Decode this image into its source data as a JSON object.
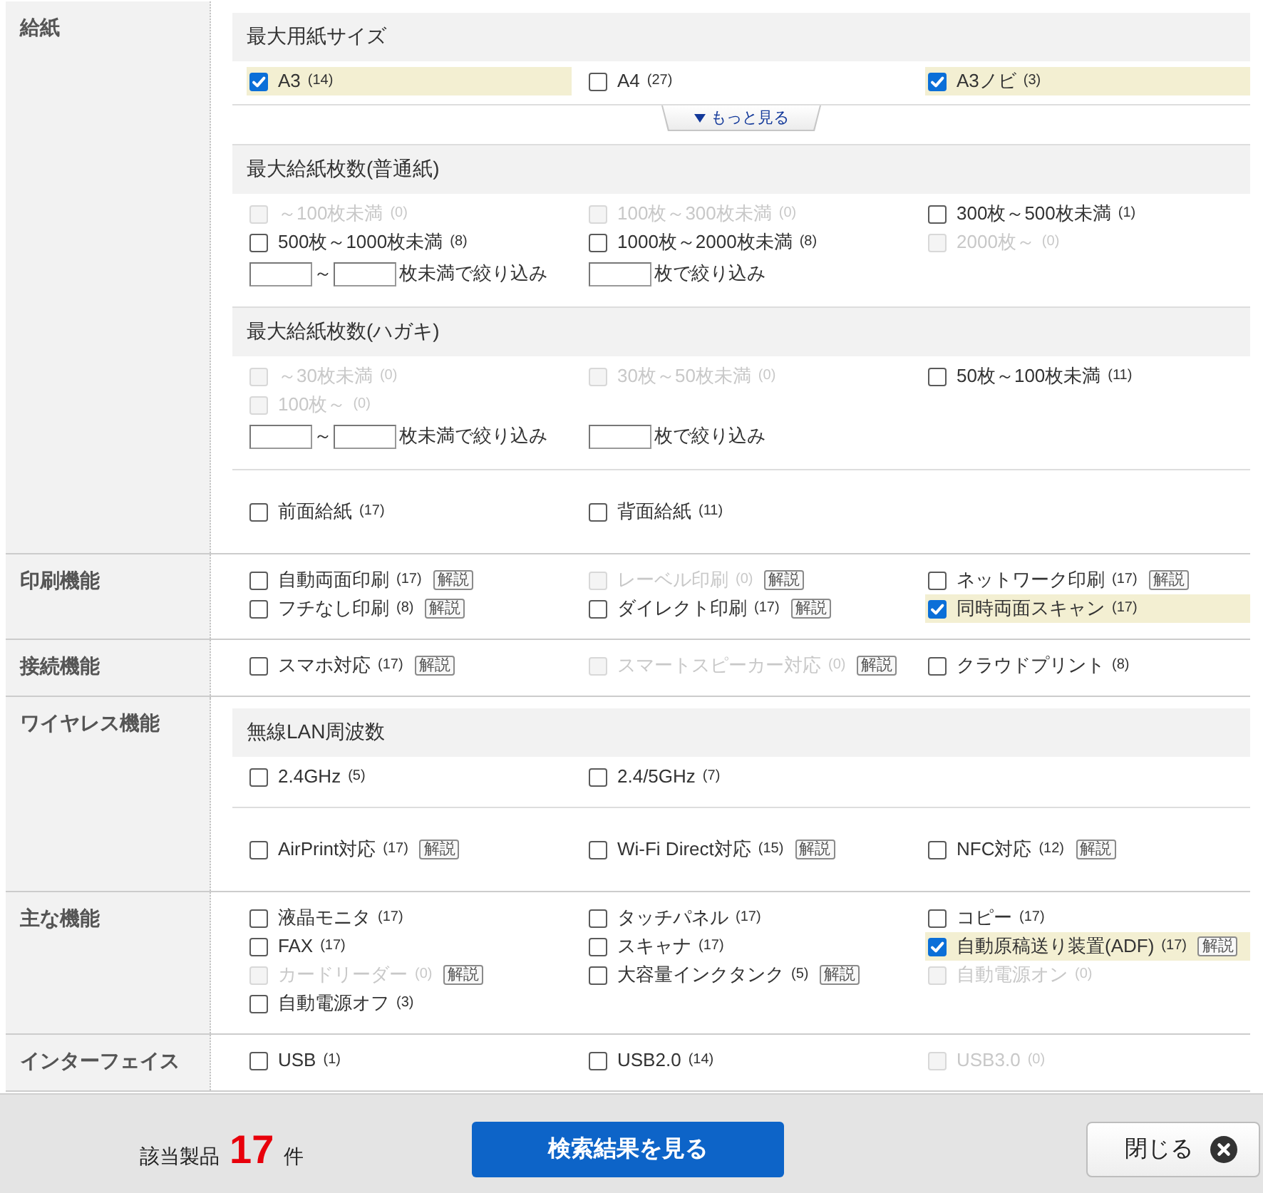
{
  "sections": [
    {
      "label": "給紙",
      "groups": [
        {
          "title": "最大用紙サイズ",
          "options": [
            {
              "label": "A3",
              "count": "(14)",
              "checked": true,
              "disabled": false
            },
            {
              "label": "A4",
              "count": "(27)",
              "checked": false,
              "disabled": false
            },
            {
              "label": "A3ノビ",
              "count": "(3)",
              "checked": true,
              "disabled": false
            }
          ],
          "more_link": "もっと見る"
        },
        {
          "title": "最大給紙枚数(普通紙)",
          "options": [
            {
              "label": "～100枚未満",
              "count": "(0)",
              "checked": false,
              "disabled": true
            },
            {
              "label": "100枚～300枚未満",
              "count": "(0)",
              "checked": false,
              "disabled": true
            },
            {
              "label": "300枚～500枚未満",
              "count": "(1)",
              "checked": false,
              "disabled": false
            },
            {
              "label": "500枚～1000枚未満",
              "count": "(8)",
              "checked": false,
              "disabled": false
            },
            {
              "label": "1000枚～2000枚未満",
              "count": "(8)",
              "checked": false,
              "disabled": false
            },
            {
              "label": "2000枚～",
              "count": "(0)",
              "checked": false,
              "disabled": true
            }
          ],
          "filters": [
            {
              "kind": "range",
              "separator": "～",
              "suffix": "枚未満で絞り込み"
            },
            {
              "kind": "single",
              "suffix": "枚で絞り込み"
            }
          ]
        },
        {
          "title": "最大給紙枚数(ハガキ)",
          "options": [
            {
              "label": "～30枚未満",
              "count": "(0)",
              "checked": false,
              "disabled": true
            },
            {
              "label": "30枚～50枚未満",
              "count": "(0)",
              "checked": false,
              "disabled": true
            },
            {
              "label": "50枚～100枚未満",
              "count": "(11)",
              "checked": false,
              "disabled": false
            },
            {
              "label": "100枚～",
              "count": "(0)",
              "checked": false,
              "disabled": true
            }
          ],
          "filters": [
            {
              "kind": "range",
              "separator": "～",
              "suffix": "枚未満で絞り込み"
            },
            {
              "kind": "single",
              "suffix": "枚で絞り込み"
            }
          ]
        },
        {
          "options": [
            {
              "label": "前面給紙",
              "count": "(17)",
              "checked": false,
              "disabled": false
            },
            {
              "label": "背面給紙",
              "count": "(11)",
              "checked": false,
              "disabled": false
            }
          ]
        }
      ]
    },
    {
      "label": "印刷機能",
      "groups": [
        {
          "options": [
            {
              "label": "自動両面印刷",
              "count": "(17)",
              "checked": false,
              "disabled": false,
              "help": "解説"
            },
            {
              "label": "レーベル印刷",
              "count": "(0)",
              "checked": false,
              "disabled": true,
              "help": "解説"
            },
            {
              "label": "ネットワーク印刷",
              "count": "(17)",
              "checked": false,
              "disabled": false,
              "help": "解説"
            },
            {
              "label": "フチなし印刷",
              "count": "(8)",
              "checked": false,
              "disabled": false,
              "help": "解説"
            },
            {
              "label": "ダイレクト印刷",
              "count": "(17)",
              "checked": false,
              "disabled": false,
              "help": "解説"
            },
            {
              "label": "同時両面スキャン",
              "count": "(17)",
              "checked": true,
              "disabled": false
            }
          ]
        }
      ]
    },
    {
      "label": "接続機能",
      "groups": [
        {
          "options": [
            {
              "label": "スマホ対応",
              "count": "(17)",
              "checked": false,
              "disabled": false,
              "help": "解説"
            },
            {
              "label": "スマートスピーカー対応",
              "count": "(0)",
              "checked": false,
              "disabled": true,
              "help": "解説"
            },
            {
              "label": "クラウドプリント",
              "count": "(8)",
              "checked": false,
              "disabled": false
            }
          ]
        }
      ]
    },
    {
      "label": "ワイヤレス機能",
      "groups": [
        {
          "title": "無線LAN周波数",
          "options": [
            {
              "label": "2.4GHz",
              "count": "(5)",
              "checked": false,
              "disabled": false
            },
            {
              "label": "2.4/5GHz",
              "count": "(7)",
              "checked": false,
              "disabled": false
            }
          ]
        },
        {
          "options": [
            {
              "label": "AirPrint対応",
              "count": "(17)",
              "checked": false,
              "disabled": false,
              "help": "解説"
            },
            {
              "label": "Wi-Fi Direct対応",
              "count": "(15)",
              "checked": false,
              "disabled": false,
              "help": "解説"
            },
            {
              "label": "NFC対応",
              "count": "(12)",
              "checked": false,
              "disabled": false,
              "help": "解説"
            }
          ]
        }
      ]
    },
    {
      "label": "主な機能",
      "groups": [
        {
          "options": [
            {
              "label": "液晶モニタ",
              "count": "(17)",
              "checked": false,
              "disabled": false
            },
            {
              "label": "タッチパネル",
              "count": "(17)",
              "checked": false,
              "disabled": false
            },
            {
              "label": "コピー",
              "count": "(17)",
              "checked": false,
              "disabled": false
            },
            {
              "label": "FAX",
              "count": "(17)",
              "checked": false,
              "disabled": false
            },
            {
              "label": "スキャナ",
              "count": "(17)",
              "checked": false,
              "disabled": false
            },
            {
              "label": "自動原稿送り装置(ADF)",
              "count": "(17)",
              "checked": true,
              "disabled": false,
              "help": "解説"
            },
            {
              "label": "カードリーダー",
              "count": "(0)",
              "checked": false,
              "disabled": true,
              "help": "解説"
            },
            {
              "label": "大容量インクタンク",
              "count": "(5)",
              "checked": false,
              "disabled": false,
              "help": "解説"
            },
            {
              "label": "自動電源オン",
              "count": "(0)",
              "checked": false,
              "disabled": true
            },
            {
              "label": "自動電源オフ",
              "count": "(3)",
              "checked": false,
              "disabled": false
            }
          ]
        }
      ]
    },
    {
      "label": "インターフェイス",
      "groups": [
        {
          "options": [
            {
              "label": "USB",
              "count": "(1)",
              "checked": false,
              "disabled": false
            },
            {
              "label": "USB2.0",
              "count": "(14)",
              "checked": false,
              "disabled": false
            },
            {
              "label": "USB3.0",
              "count": "(0)",
              "checked": false,
              "disabled": true
            }
          ]
        }
      ]
    }
  ],
  "footer": {
    "result_label": "該当製品",
    "result_count": "17",
    "result_unit": "件",
    "search_button": "検索結果を見る",
    "close_button": "閉じる"
  }
}
